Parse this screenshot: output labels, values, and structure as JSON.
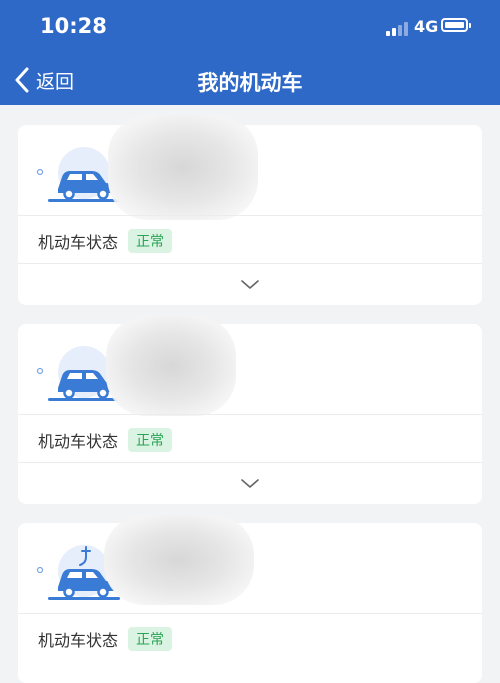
{
  "status_bar": {
    "time": "10:28",
    "network": "4G"
  },
  "nav": {
    "back_label": "返回",
    "title": "我的机动车"
  },
  "vehicles": [
    {
      "icon": "car-icon",
      "status_label": "机动车状态",
      "status_value": "正常",
      "redacted_text": ""
    },
    {
      "icon": "car-icon",
      "status_label": "机动车状态",
      "status_value": "正常",
      "redacted_text": ""
    },
    {
      "icon": "electric-car-icon",
      "status_label": "机动车状态",
      "status_value": "正常",
      "redacted_text": ""
    }
  ],
  "colors": {
    "header_blue": "#2f69c8",
    "badge_bg": "#dbf3e2",
    "badge_text": "#2aa355",
    "icon_blue": "#3a7bd5",
    "page_bg": "#f2f3f5"
  }
}
